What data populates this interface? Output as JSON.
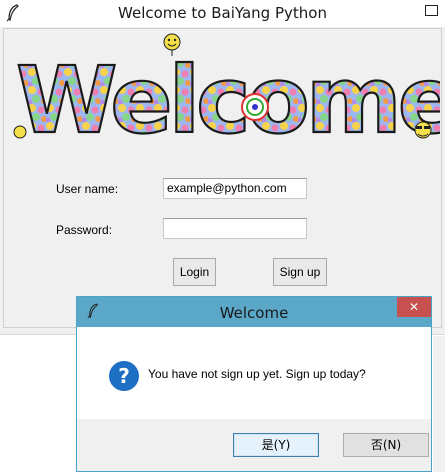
{
  "window": {
    "title": "Welcome to BaiYang Python"
  },
  "banner": {
    "text": "Welcome"
  },
  "form": {
    "username_label": "User name:",
    "username_value": "example@python.com",
    "password_label": "Password:",
    "password_value": "",
    "login_label": "Login",
    "signup_label": "Sign up"
  },
  "dialog": {
    "title": "Welcome",
    "message": "You have not sign up yet. Sign up today?",
    "close_glyph": "✕",
    "icon_glyph": "?",
    "yes_label": "是(Y)",
    "no_label": "否(N)"
  },
  "colors": {
    "dialog_title_bar": "#5aa7c7",
    "dialog_close": "#c75050",
    "question_icon": "#1c6fc2"
  }
}
